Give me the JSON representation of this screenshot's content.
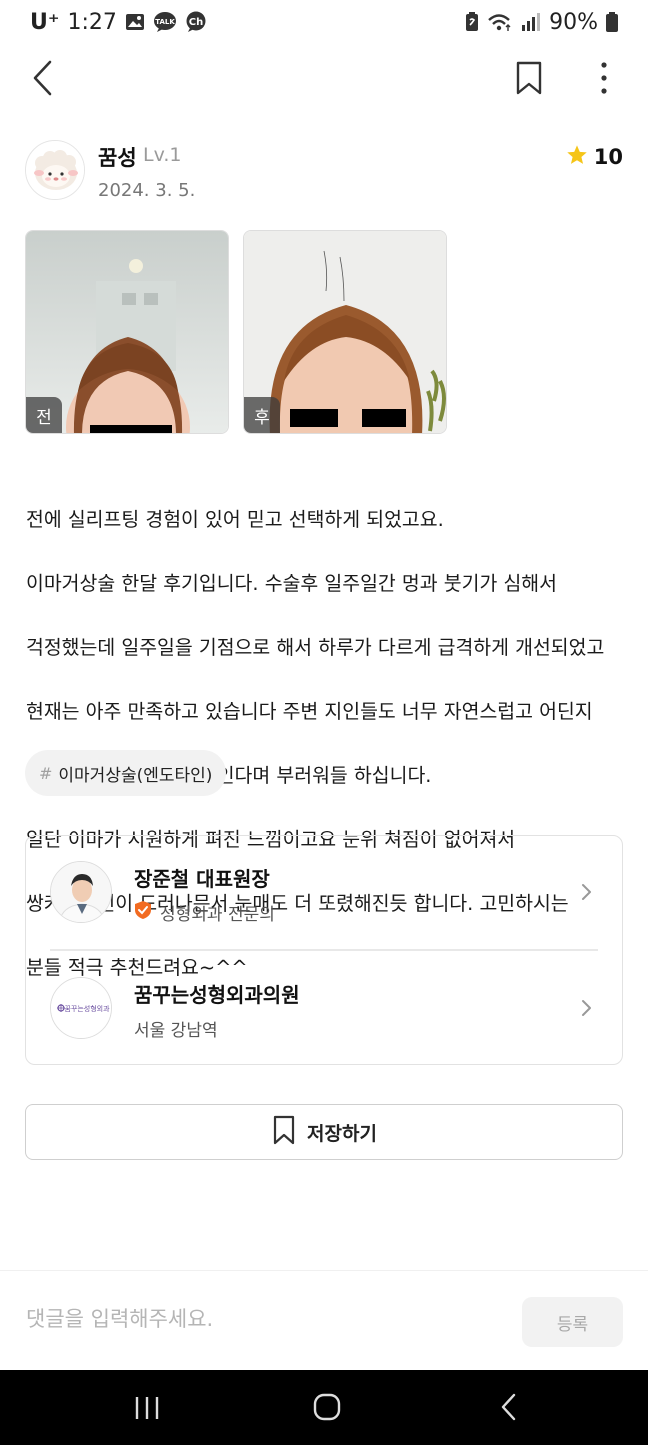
{
  "status_bar": {
    "carrier": "U⁺",
    "time": "1:27",
    "icons_left": [
      "gallery-icon",
      "talk-icon",
      "channel-icon"
    ],
    "icons_right": [
      "nfc-icon",
      "wifi-icon",
      "signal-icon",
      "battery-icon"
    ],
    "battery": "90%"
  },
  "nav": {
    "back_icon": "back-arrow-icon",
    "bookmark_icon": "bookmark-icon",
    "more_icon": "more-vertical-icon"
  },
  "author": {
    "name": "꿈성",
    "level": "Lv.1",
    "date": "2024. 3. 5.",
    "rating": "10",
    "avatar_icon": "sheep-avatar-icon"
  },
  "photos": [
    {
      "tag": "전"
    },
    {
      "tag": "후"
    }
  ],
  "review": {
    "lines": [
      "전에 실리프팅 경험이 있어 믿고 선택하게 되었고요.",
      "이마거상술 한달 후기입니다. 수술후 일주일간 멍과 붓기가 심해서",
      "걱정했는데 일주일을 기점으로 해서 하루가 다르게 급격하게 개선되었고",
      "현재는 아주 만족하고 있습니다 주변 지인들도 너무 자연스럽고 어딘지",
      "모르게 이뻐지고 어려보인다며 부러워들 하십니다.",
      "일단 이마가 시원하게 펴진 느낌이고요 눈위 쳐짐이 없어져서",
      "쌍커플라인이 드러나믄서 눈매도 더 또렸해진듯 합니다. 고민하시는",
      "분들 적극 추천드려요~^^"
    ]
  },
  "tag": {
    "hash": "#",
    "label": "이마거상술(엔도타인)"
  },
  "doctor": {
    "name": "장준철 대표원장",
    "specialty": "성형외과 전문의"
  },
  "clinic": {
    "name": "꿈꾸는성형외과의원",
    "location": "서울 강남역",
    "logo_text": "꿈꾸는성형외과"
  },
  "save": {
    "label": "저장하기"
  },
  "comment": {
    "placeholder": "댓글을 입력해주세요.",
    "submit_label": "등록"
  },
  "colors": {
    "star": "#f5c518",
    "verified_badge": "#f26b21",
    "clinic_logo": "#6b4fa0"
  }
}
